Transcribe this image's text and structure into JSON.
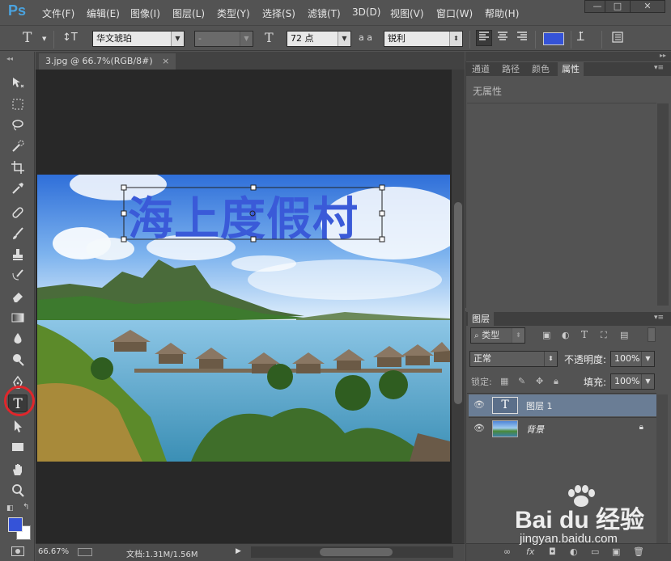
{
  "menubar": {
    "logo": "Ps",
    "items": [
      "文件(F)",
      "编辑(E)",
      "图像(I)",
      "图层(L)",
      "类型(Y)",
      "选择(S)",
      "滤镜(T)",
      "3D(D)",
      "视图(V)",
      "窗口(W)",
      "帮助(H)"
    ],
    "window_buttons": [
      "—",
      "□",
      "✕"
    ]
  },
  "options": {
    "tool_glyph": "T",
    "orient_glyph": "↕T",
    "font_family": "华文琥珀",
    "font_style": "-",
    "size_glyph": "T",
    "font_size": "72 点",
    "aa_glyph": "a a",
    "antialias": "锐利",
    "text_color": "#3553d8"
  },
  "document": {
    "tab_title": "3.jpg @ 66.7%(RGB/8#)",
    "tab_close": "×",
    "canvas_text": "海上度假村",
    "canvas_text_color": "#3a5ad8"
  },
  "status": {
    "zoom": "66.67%",
    "doc_info": "文档:1.31M/1.56M",
    "arrow": "▶"
  },
  "panels_top": {
    "tabs": [
      "通道",
      "路径",
      "颜色",
      "属性"
    ],
    "active_tab": "属性",
    "content": "无属性"
  },
  "layers": {
    "tab": "图层",
    "filter_label": "类型",
    "blend_mode": "正常",
    "opacity_label": "不透明度:",
    "opacity_value": "100%",
    "lock_label": "锁定:",
    "fill_label": "填充:",
    "fill_value": "100%",
    "rows": [
      {
        "name": "图层 1",
        "thumb": "T",
        "selected": true
      },
      {
        "name": "背景",
        "locked": true
      }
    ],
    "footer_icons": [
      "∞",
      "fx",
      "◘",
      "◐",
      "▭",
      "▣",
      "🗑"
    ]
  },
  "watermark": {
    "brand": "Bai du 经验",
    "url": "jingyan.baidu.com"
  },
  "colors": {
    "foreground": "#3553d8",
    "background": "#ffffff",
    "highlight_circle": "#e0262b"
  }
}
